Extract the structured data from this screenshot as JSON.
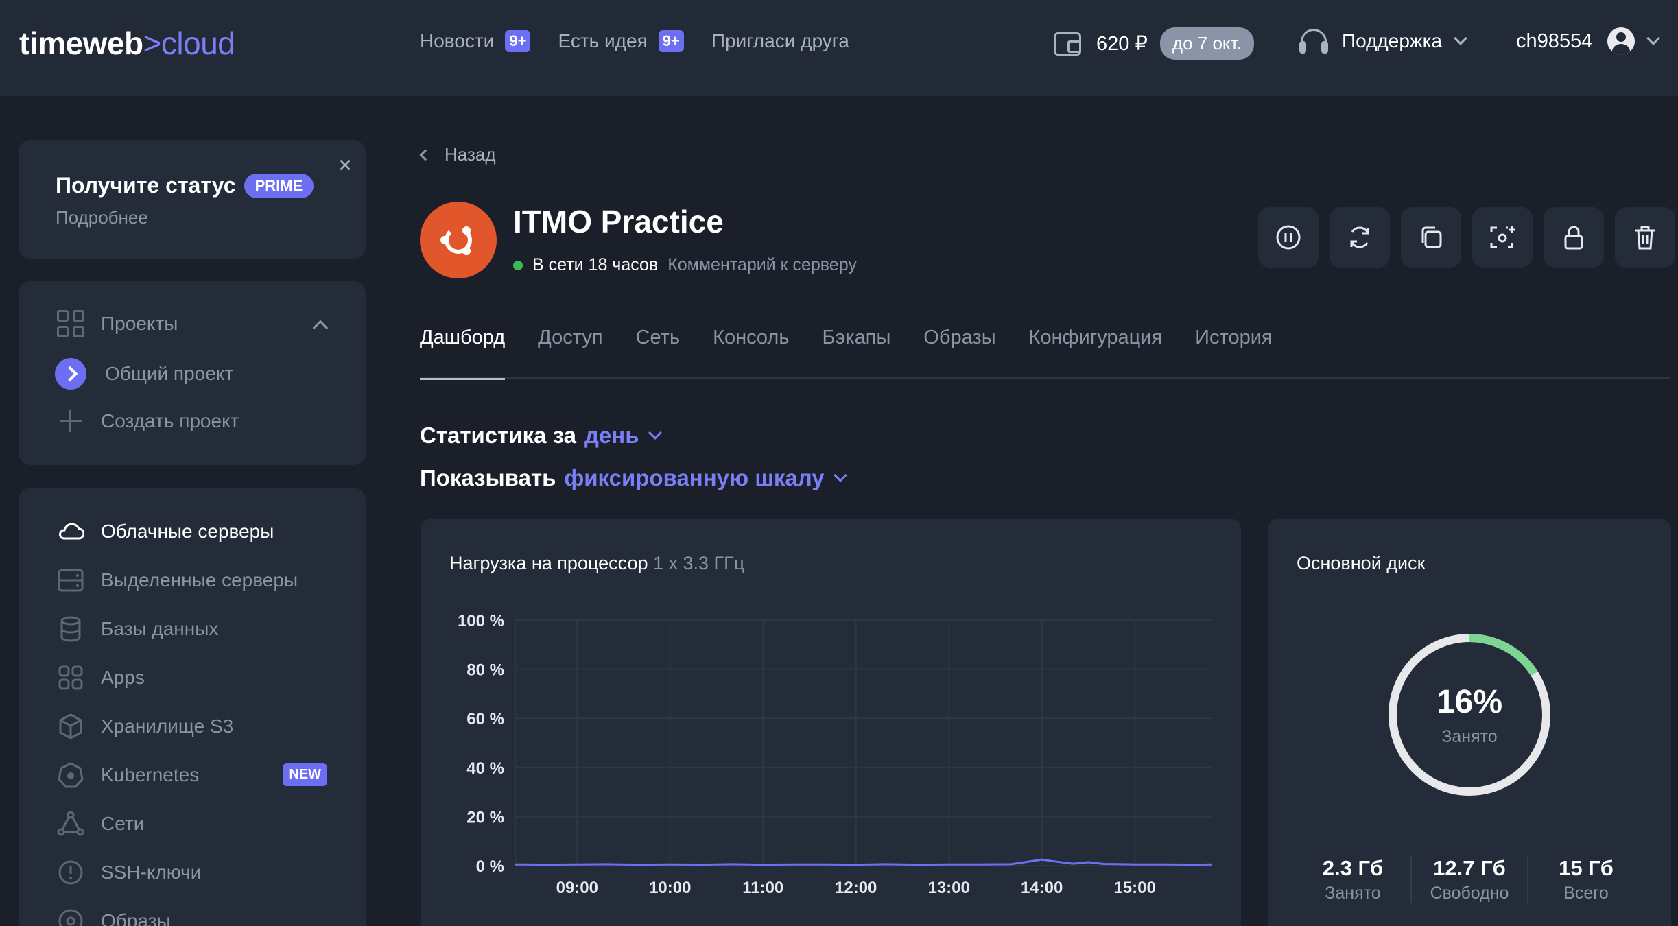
{
  "brand": {
    "name": "timeweb",
    "arrow": ">",
    "suffix": "cloud"
  },
  "topnav": [
    {
      "label": "Новости",
      "badge": "9+"
    },
    {
      "label": "Есть идея",
      "badge": "9+"
    },
    {
      "label": "Пригласи друга",
      "badge": null
    }
  ],
  "balance": {
    "amount": "620 ₽",
    "until": "до 7 окт."
  },
  "support": {
    "label": "Поддержка"
  },
  "user": {
    "login": "ch98554"
  },
  "promo": {
    "title": "Получите статус",
    "badge": "PRIME",
    "more": "Подробнее",
    "close": "×"
  },
  "projects": {
    "header": "Проекты",
    "current": "Общий проект",
    "create": "Создать проект"
  },
  "services": [
    {
      "label": "Облачные серверы",
      "icon": "cloud-icon",
      "active": true
    },
    {
      "label": "Выделенные серверы",
      "icon": "server-icon"
    },
    {
      "label": "Базы данных",
      "icon": "database-icon"
    },
    {
      "label": "Apps",
      "icon": "apps-icon"
    },
    {
      "label": "Хранилище S3",
      "icon": "cube-icon"
    },
    {
      "label": "Kubernetes",
      "icon": "kubernetes-icon",
      "badge": "NEW"
    },
    {
      "label": "Сети",
      "icon": "network-icon"
    },
    {
      "label": "SSH-ключи",
      "icon": "key-icon"
    },
    {
      "label": "Образы",
      "icon": "image-icon"
    }
  ],
  "server": {
    "back": "Назад",
    "name": "ITMO Practice",
    "status": "В сети 18 часов",
    "comment": "Комментарий к серверу"
  },
  "tabs": [
    "Дашборд",
    "Доступ",
    "Сеть",
    "Консоль",
    "Бэкапы",
    "Образы",
    "Конфигурация",
    "История"
  ],
  "stats": {
    "period_label": "Статистика за",
    "period_value": "день",
    "scale_label": "Показывать",
    "scale_value": "фиксированную шкалу"
  },
  "cpu": {
    "title": "Нагрузка на процессор",
    "subtitle": "1 x 3.3 ГГц"
  },
  "chart_data": {
    "type": "line",
    "title": "Нагрузка на процессор",
    "ylim": [
      0,
      100
    ],
    "y_ticks": [
      "100 %",
      "80 %",
      "60 %",
      "40 %",
      "20 %",
      "0 %"
    ],
    "x_ticks": [
      "09:00",
      "10:00",
      "11:00",
      "12:00",
      "13:00",
      "14:00",
      "15:00"
    ],
    "grid": true,
    "series": [
      {
        "color": "#6c6ff2",
        "x": [
          "08:20",
          "08:40",
          "09:00",
          "09:20",
          "09:40",
          "10:00",
          "10:20",
          "10:40",
          "11:00",
          "11:20",
          "11:40",
          "12:00",
          "12:20",
          "12:40",
          "13:00",
          "13:20",
          "13:40",
          "13:50",
          "14:00",
          "14:10",
          "14:20",
          "14:30",
          "14:40",
          "15:00",
          "15:20",
          "15:40",
          "15:50"
        ],
        "values": [
          0.5,
          0.4,
          0.5,
          0.6,
          0.4,
          0.5,
          0.4,
          0.6,
          0.4,
          0.5,
          0.5,
          0.4,
          0.6,
          0.4,
          0.5,
          0.5,
          0.6,
          1.5,
          2.5,
          1.6,
          0.8,
          1.4,
          0.7,
          0.5,
          0.5,
          0.4,
          0.5
        ]
      }
    ]
  },
  "disk": {
    "title": "Основной диск",
    "used_pct": 16,
    "used_pct_label": "16%",
    "used_label": "Занято",
    "stats": [
      {
        "value": "2.3 Гб",
        "label": "Занято"
      },
      {
        "value": "12.7 Гб",
        "label": "Свободно"
      },
      {
        "value": "15 Гб",
        "label": "Всего"
      }
    ],
    "accent": "#7ed492"
  }
}
